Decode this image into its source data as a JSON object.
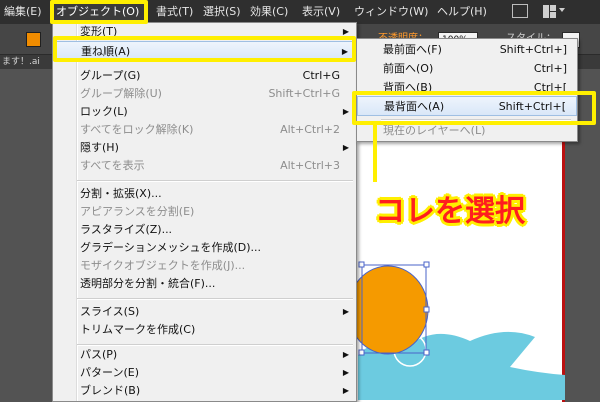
{
  "menubar": {
    "items": [
      "編集(E)",
      "オブジェクト(O)",
      "書式(T)",
      "選択(S)",
      "効果(C)",
      "表示(V)",
      "ウィンドウ(W)",
      "ヘルプ(H)"
    ]
  },
  "controlbar": {
    "opacity_label": "不透明度：",
    "opacity_value": "100%",
    "style_label": "スタイル："
  },
  "tabstrip": {
    "text": "ます！.ai"
  },
  "object_menu": {
    "items": [
      {
        "label": "変形(T)",
        "shortcut": "",
        "submenu": true,
        "disabled": false
      },
      {
        "label": "重ね順(A)",
        "shortcut": "",
        "submenu": true,
        "disabled": false
      },
      {
        "label": "グループ(G)",
        "shortcut": "Ctrl+G",
        "submenu": false,
        "disabled": false
      },
      {
        "label": "グループ解除(U)",
        "shortcut": "Shift+Ctrl+G",
        "submenu": false,
        "disabled": true
      },
      {
        "label": "ロック(L)",
        "shortcut": "",
        "submenu": true,
        "disabled": false
      },
      {
        "label": "すべてをロック解除(K)",
        "shortcut": "Alt+Ctrl+2",
        "submenu": false,
        "disabled": true
      },
      {
        "label": "隠す(H)",
        "shortcut": "",
        "submenu": true,
        "disabled": false
      },
      {
        "label": "すべてを表示",
        "shortcut": "Alt+Ctrl+3",
        "submenu": false,
        "disabled": true
      },
      {
        "label": "分割・拡張(X)...",
        "shortcut": "",
        "submenu": false,
        "disabled": false
      },
      {
        "label": "アピアランスを分割(E)",
        "shortcut": "",
        "submenu": false,
        "disabled": true
      },
      {
        "label": "ラスタライズ(Z)...",
        "shortcut": "",
        "submenu": false,
        "disabled": false
      },
      {
        "label": "グラデーションメッシュを作成(D)...",
        "shortcut": "",
        "submenu": false,
        "disabled": false
      },
      {
        "label": "モザイクオブジェクトを作成(J)...",
        "shortcut": "",
        "submenu": false,
        "disabled": true
      },
      {
        "label": "透明部分を分割・統合(F)...",
        "shortcut": "",
        "submenu": false,
        "disabled": false
      },
      {
        "label": "スライス(S)",
        "shortcut": "",
        "submenu": true,
        "disabled": false
      },
      {
        "label": "トリムマークを作成(C)",
        "shortcut": "",
        "submenu": false,
        "disabled": false
      },
      {
        "label": "パス(P)",
        "shortcut": "",
        "submenu": true,
        "disabled": false
      },
      {
        "label": "パターン(E)",
        "shortcut": "",
        "submenu": true,
        "disabled": false
      },
      {
        "label": "ブレンド(B)",
        "shortcut": "",
        "submenu": true,
        "disabled": false
      }
    ]
  },
  "arrange_submenu": {
    "items": [
      {
        "label": "最前面へ(F)",
        "shortcut": "Shift+Ctrl+]",
        "disabled": false
      },
      {
        "label": "前面へ(O)",
        "shortcut": "Ctrl+]",
        "disabled": false
      },
      {
        "label": "背面へ(B)",
        "shortcut": "Ctrl+[",
        "disabled": false
      },
      {
        "label": "最背面へ(A)",
        "shortcut": "Shift+Ctrl+[",
        "disabled": false
      },
      {
        "label": "現在のレイヤーへ(L)",
        "shortcut": "",
        "disabled": true
      }
    ]
  },
  "annotation": {
    "text": "コレを選択"
  },
  "colors": {
    "highlight_yellow": "#ffef00",
    "annotation_red": "#ff1e1e",
    "fill_orange": "#f59a00",
    "cloud_cyan": "#6ccbe0"
  }
}
